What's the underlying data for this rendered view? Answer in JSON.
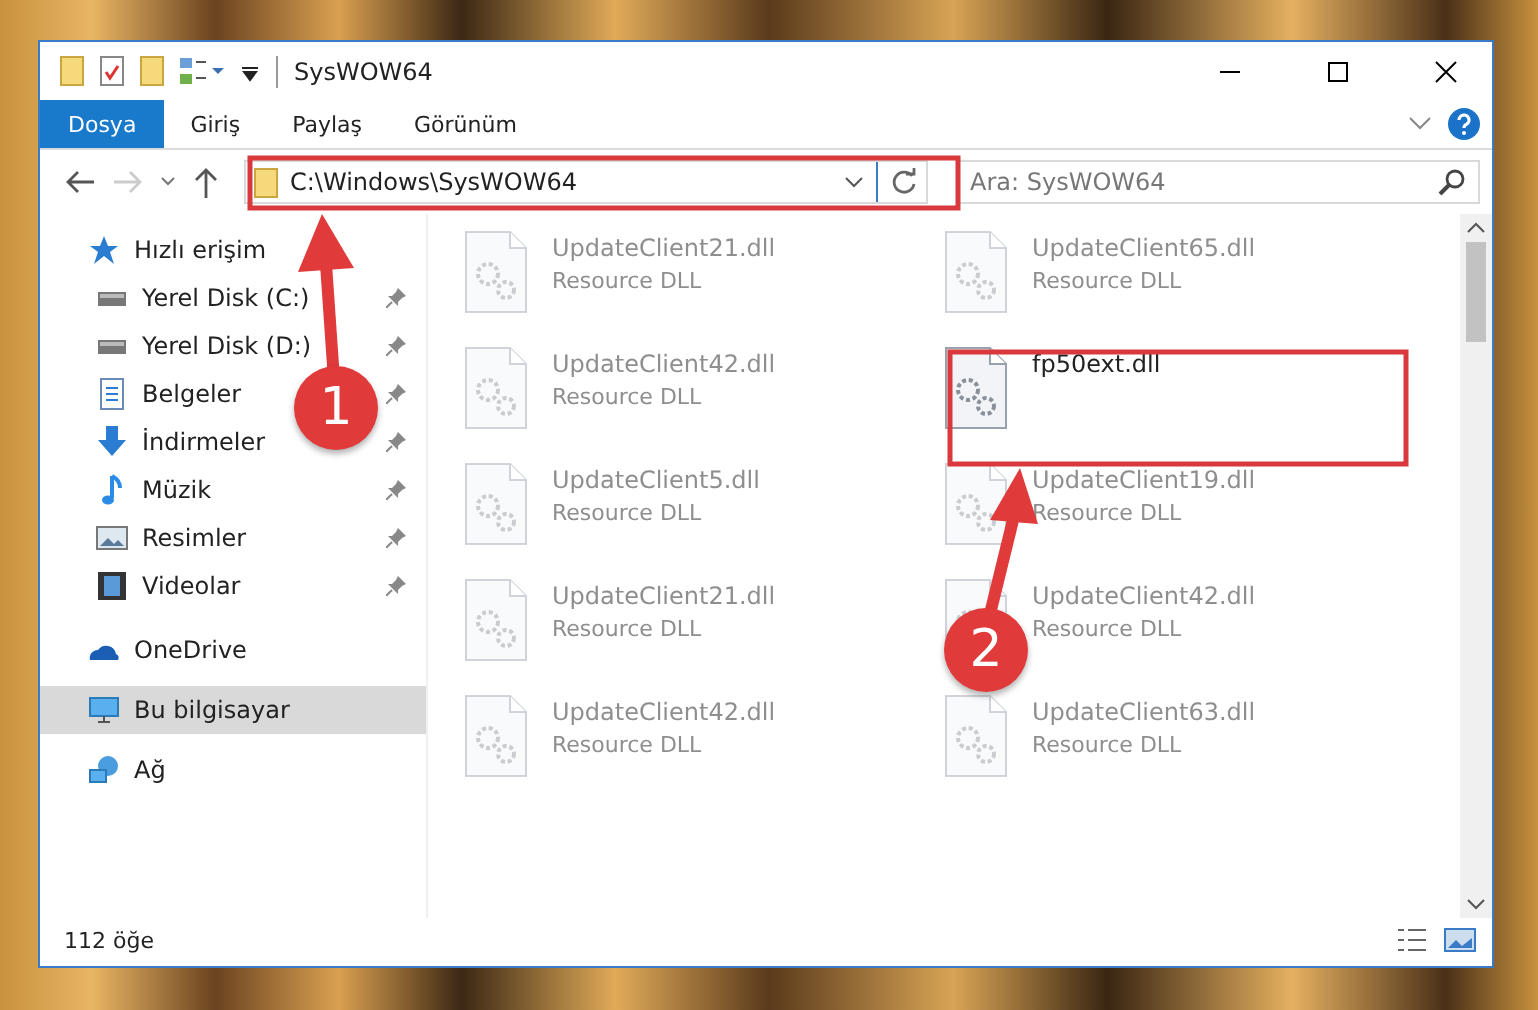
{
  "window": {
    "title": "SysWOW64"
  },
  "ribbon_tabs": [
    {
      "label": "Dosya",
      "selected": true
    },
    {
      "label": "Giriş",
      "selected": false
    },
    {
      "label": "Paylaş",
      "selected": false
    },
    {
      "label": "Görünüm",
      "selected": false
    }
  ],
  "address_bar": {
    "value": "C:\\Windows\\SysWOW64"
  },
  "search": {
    "placeholder": "Ara: SysWOW64"
  },
  "sidebar": {
    "items": [
      {
        "label": "Hızlı erişim",
        "kind": "star",
        "selected": false,
        "children": [
          {
            "label": "Yerel Disk (C:)",
            "kind": "drive",
            "pinned": true,
            "selected": false
          },
          {
            "label": "Yerel Disk (D:)",
            "kind": "drive",
            "pinned": true,
            "selected": false
          },
          {
            "label": "Belgeler",
            "kind": "documents",
            "pinned": true,
            "selected": false
          },
          {
            "label": "İndirmeler",
            "kind": "downloads",
            "pinned": true,
            "selected": false
          },
          {
            "label": "Müzik",
            "kind": "music",
            "pinned": true,
            "selected": false
          },
          {
            "label": "Resimler",
            "kind": "pictures",
            "pinned": true,
            "selected": false
          },
          {
            "label": "Videolar",
            "kind": "videos",
            "pinned": true,
            "selected": false
          }
        ]
      },
      {
        "label": "OneDrive",
        "kind": "cloud",
        "selected": false
      },
      {
        "label": "Bu bilgisayar",
        "kind": "computer",
        "selected": true
      },
      {
        "label": "Ağ",
        "kind": "network",
        "selected": false
      }
    ]
  },
  "files": [
    {
      "name": "UpdateClient21.dll",
      "type": "Resource DLL",
      "kind": "blurred"
    },
    {
      "name": "UpdateClient65.dll",
      "type": "Resource DLL",
      "kind": "blurred"
    },
    {
      "name": "UpdateClient42.dll",
      "type": "Resource DLL",
      "kind": "blurred"
    },
    {
      "name": "fp50ext.dll",
      "kind": "highlighted"
    },
    {
      "name": "UpdateClient5.dll",
      "type": "Resource DLL",
      "kind": "blurred"
    },
    {
      "name": "UpdateClient19.dll",
      "type": "Resource DLL",
      "kind": "blurred"
    },
    {
      "name": "UpdateClient21.dll",
      "type": "Resource DLL",
      "kind": "blurred"
    },
    {
      "name": "UpdateClient42.dll",
      "type": "Resource DLL",
      "kind": "blurred"
    },
    {
      "name": "UpdateClient42.dll",
      "type": "Resource DLL",
      "kind": "blurred"
    },
    {
      "name": "UpdateClient63.dll",
      "type": "Resource DLL",
      "kind": "blurred"
    }
  ],
  "status_bar": {
    "count": "112 öğe"
  },
  "annotations": [
    {
      "number": "1"
    },
    {
      "number": "2"
    }
  ]
}
